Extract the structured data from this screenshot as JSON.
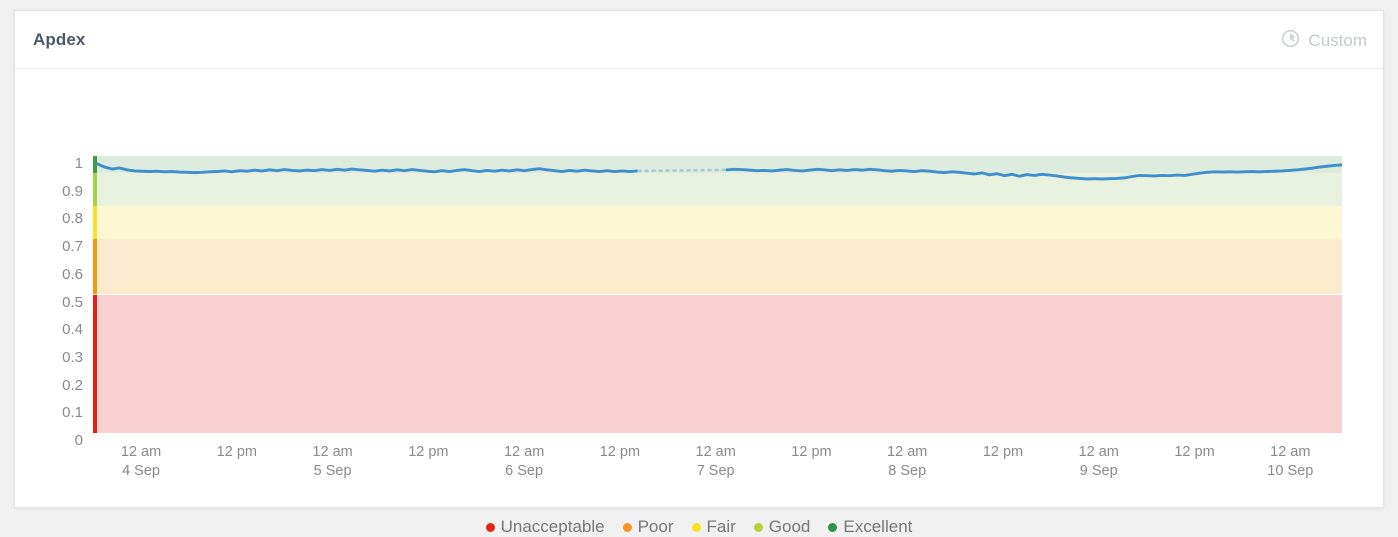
{
  "panel": {
    "title": "Apdex",
    "time_range_label": "Custom",
    "time_range_icon": "clock-icon",
    "background": "#f1f1f1",
    "card_background": "#ffffff"
  },
  "chart_data": {
    "type": "line",
    "title": "Apdex",
    "xlabel": "",
    "ylabel": "",
    "ylim": [
      0,
      1
    ],
    "grid": false,
    "legend_position": "bottom-center",
    "series_color": "#3f8fce",
    "y_ticks": [
      "1",
      "0.9",
      "0.8",
      "0.7",
      "0.6",
      "0.5",
      "0.4",
      "0.3",
      "0.2",
      "0.1",
      "0"
    ],
    "y_tick_values": [
      1,
      0.9,
      0.8,
      0.7,
      0.6,
      0.5,
      0.4,
      0.3,
      0.2,
      0.1,
      0
    ],
    "x_ticks": [
      {
        "time": "12 am",
        "date": "4 Sep"
      },
      {
        "time": "12 pm",
        "date": ""
      },
      {
        "time": "12 am",
        "date": "5 Sep"
      },
      {
        "time": "12 pm",
        "date": ""
      },
      {
        "time": "12 am",
        "date": "6 Sep"
      },
      {
        "time": "12 pm",
        "date": ""
      },
      {
        "time": "12 am",
        "date": "7 Sep"
      },
      {
        "time": "12 pm",
        "date": ""
      },
      {
        "time": "12 am",
        "date": "8 Sep"
      },
      {
        "time": "12 pm",
        "date": ""
      },
      {
        "time": "12 am",
        "date": "9 Sep"
      },
      {
        "time": "12 pm",
        "date": ""
      },
      {
        "time": "12 am",
        "date": "10 Sep"
      }
    ],
    "bands": [
      {
        "label": "Excellent",
        "from": 0.94,
        "to": 1.0,
        "fill": "#dcecdf",
        "marker": "#3e9e45"
      },
      {
        "label": "Good",
        "from": 0.82,
        "to": 0.94,
        "fill": "#e8f2de",
        "marker": "#a9d24b"
      },
      {
        "label": "Fair",
        "from": 0.7,
        "to": 0.82,
        "fill": "#fcf8d4",
        "marker": "#fbe21f"
      },
      {
        "label": "Poor",
        "from": 0.5,
        "to": 0.7,
        "fill": "#fdebcf",
        "marker": "#f79813"
      },
      {
        "label": "Unacceptable",
        "from": 0.0,
        "to": 0.5,
        "fill": "#f7d2d0",
        "marker": "#ea1c14"
      }
    ],
    "legend": [
      {
        "label": "Unacceptable",
        "color": "#e52412"
      },
      {
        "label": "Poor",
        "color": "#f7931e"
      },
      {
        "label": "Fair",
        "color": "#fbe21f"
      },
      {
        "label": "Good",
        "color": "#b5d334"
      },
      {
        "label": "Excellent",
        "color": "#2f9246"
      }
    ],
    "series": [
      {
        "name": "Apdex",
        "color": "#3f8fce",
        "has_gap": true,
        "gap_x_fraction": [
          0.435,
          0.505
        ],
        "gap_style": "dotted",
        "values": [
          0.972,
          0.96,
          0.953,
          0.957,
          0.95,
          0.946,
          0.945,
          0.944,
          0.945,
          0.943,
          0.944,
          0.942,
          0.941,
          0.94,
          0.941,
          0.943,
          0.944,
          0.946,
          0.943,
          0.947,
          0.945,
          0.949,
          0.946,
          0.95,
          0.947,
          0.951,
          0.948,
          0.946,
          0.949,
          0.947,
          0.951,
          0.948,
          0.952,
          0.949,
          0.953,
          0.95,
          0.948,
          0.945,
          0.949,
          0.946,
          0.95,
          0.947,
          0.951,
          0.948,
          0.945,
          0.943,
          0.947,
          0.944,
          0.948,
          0.951,
          0.947,
          0.944,
          0.948,
          0.945,
          0.949,
          0.946,
          0.95,
          0.947,
          0.951,
          0.954,
          0.95,
          0.947,
          0.944,
          0.948,
          0.945,
          0.949,
          0.946,
          0.944,
          0.947,
          0.944,
          0.946,
          0.944,
          0.946,
          0.944,
          0.946,
          0.945,
          0.947,
          0.945,
          0.947,
          0.946,
          0.946,
          0.947,
          0.948,
          0.949,
          0.95,
          0.952,
          0.951,
          0.949,
          0.947,
          0.948,
          0.946,
          0.949,
          0.951,
          0.948,
          0.946,
          0.949,
          0.952,
          0.95,
          0.947,
          0.95,
          0.948,
          0.951,
          0.949,
          0.952,
          0.95,
          0.947,
          0.945,
          0.948,
          0.946,
          0.944,
          0.947,
          0.945,
          0.942,
          0.94,
          0.943,
          0.941,
          0.938,
          0.935,
          0.939,
          0.932,
          0.936,
          0.929,
          0.934,
          0.927,
          0.933,
          0.93,
          0.934,
          0.931,
          0.928,
          0.924,
          0.921,
          0.919,
          0.917,
          0.918,
          0.917,
          0.918,
          0.919,
          0.921,
          0.926,
          0.93,
          0.929,
          0.928,
          0.93,
          0.929,
          0.931,
          0.93,
          0.934,
          0.938,
          0.941,
          0.943,
          0.942,
          0.943,
          0.942,
          0.943,
          0.944,
          0.943,
          0.944,
          0.945,
          0.946,
          0.948,
          0.95,
          0.953,
          0.956,
          0.96,
          0.963,
          0.966,
          0.968
        ]
      }
    ]
  }
}
